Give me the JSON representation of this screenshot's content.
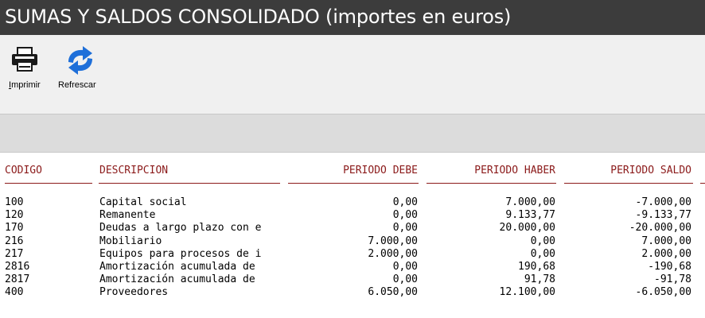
{
  "window": {
    "title": "SUMAS Y SALDOS CONSOLIDADO (importes en euros)"
  },
  "toolbar": {
    "print": {
      "label_first": "I",
      "label_rest": "mprimir",
      "icon": "printer-icon"
    },
    "refresh": {
      "label": "Refrescar",
      "icon": "refresh-icon"
    }
  },
  "colors": {
    "titlebar": "#3c3c3c",
    "header_text": "#8b1a1a",
    "toolbar_bg": "#f0f0f0",
    "band_bg": "#dcdcdc"
  },
  "report": {
    "columns": [
      "CODIGO",
      "DESCRIPCION",
      "PERIODO DEBE",
      "PERIODO HABER",
      "PERIODO SALDO"
    ],
    "rows": [
      [
        "100",
        "Capital social",
        "0,00",
        "7.000,00",
        "-7.000,00"
      ],
      [
        "120",
        "Remanente",
        "0,00",
        "9.133,77",
        "-9.133,77"
      ],
      [
        "170",
        "Deudas a largo plazo con e",
        "0,00",
        "20.000,00",
        "-20.000,00"
      ],
      [
        "216",
        "Mobiliario",
        "7.000,00",
        "0,00",
        "7.000,00"
      ],
      [
        "217",
        "Equipos para procesos de i",
        "2.000,00",
        "0,00",
        "2.000,00"
      ],
      [
        "2816",
        "Amortización acumulada de",
        "0,00",
        "190,68",
        "-190,68"
      ],
      [
        "2817",
        "Amortización acumulada de",
        "0,00",
        "91,78",
        "-91,78"
      ],
      [
        "400",
        "Proveedores",
        "6.050,00",
        "12.100,00",
        "-6.050,00"
      ]
    ]
  }
}
